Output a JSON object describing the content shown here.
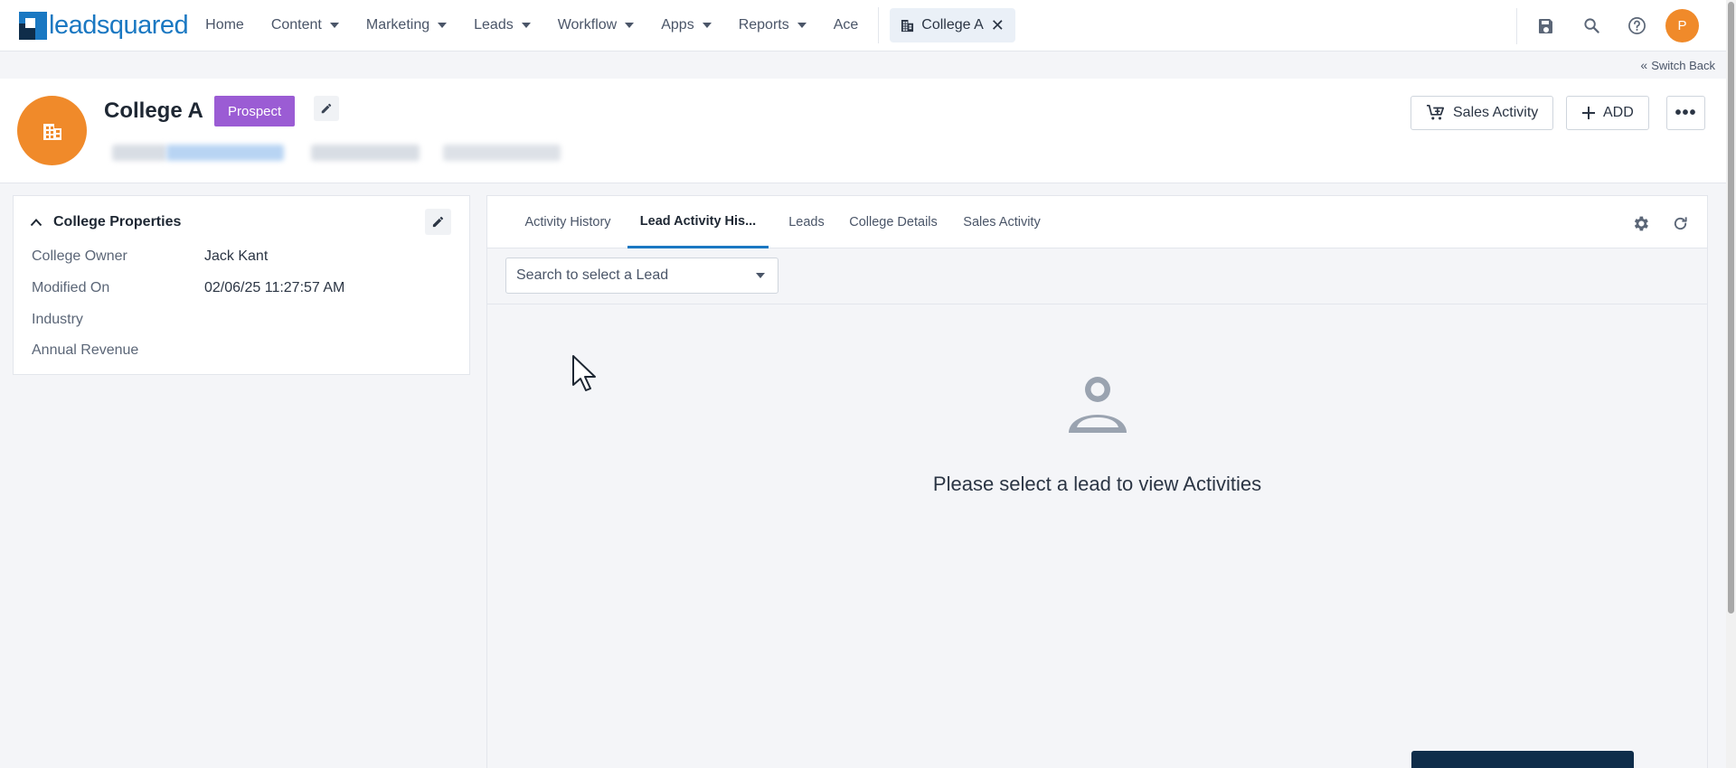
{
  "brand": {
    "logo_text": "leadsquared",
    "accent": "#1a78c2"
  },
  "nav": {
    "items": [
      {
        "label": "Home",
        "dropdown": false
      },
      {
        "label": "Content",
        "dropdown": true
      },
      {
        "label": "Marketing",
        "dropdown": true
      },
      {
        "label": "Leads",
        "dropdown": true
      },
      {
        "label": "Workflow",
        "dropdown": true
      },
      {
        "label": "Apps",
        "dropdown": true
      },
      {
        "label": "Reports",
        "dropdown": true
      },
      {
        "label": "Ace",
        "dropdown": false
      }
    ],
    "open_tab": {
      "label": "College A",
      "close": "✕"
    },
    "user_initial": "P",
    "icons": [
      "save-icon",
      "search-icon",
      "help-icon"
    ]
  },
  "switch_back": {
    "label": "Switch Back"
  },
  "header": {
    "name": "College A",
    "stage": "Prospect",
    "stage_color": "#9b5cd4",
    "avatar_color": "#f08a2a",
    "actions": {
      "sales_activity": "Sales Activity",
      "add": "ADD",
      "more": "•••"
    }
  },
  "properties": {
    "title": "College Properties",
    "rows": [
      {
        "label": "College Owner",
        "value": "Jack Kant"
      },
      {
        "label": "Modified On",
        "value": "02/06/25 11:27:57 AM"
      },
      {
        "label": "Industry",
        "value": ""
      },
      {
        "label": "Annual Revenue",
        "value": ""
      }
    ]
  },
  "activity": {
    "tabs": [
      {
        "label": "Activity History",
        "active": false
      },
      {
        "label": "Lead Activity His...",
        "active": true
      },
      {
        "label": "Leads",
        "active": false
      },
      {
        "label": "College Details",
        "active": false
      },
      {
        "label": "Sales Activity",
        "active": false
      }
    ],
    "lead_select_placeholder": "Search to select a Lead",
    "empty_message": "Please select a lead to view Activities"
  }
}
